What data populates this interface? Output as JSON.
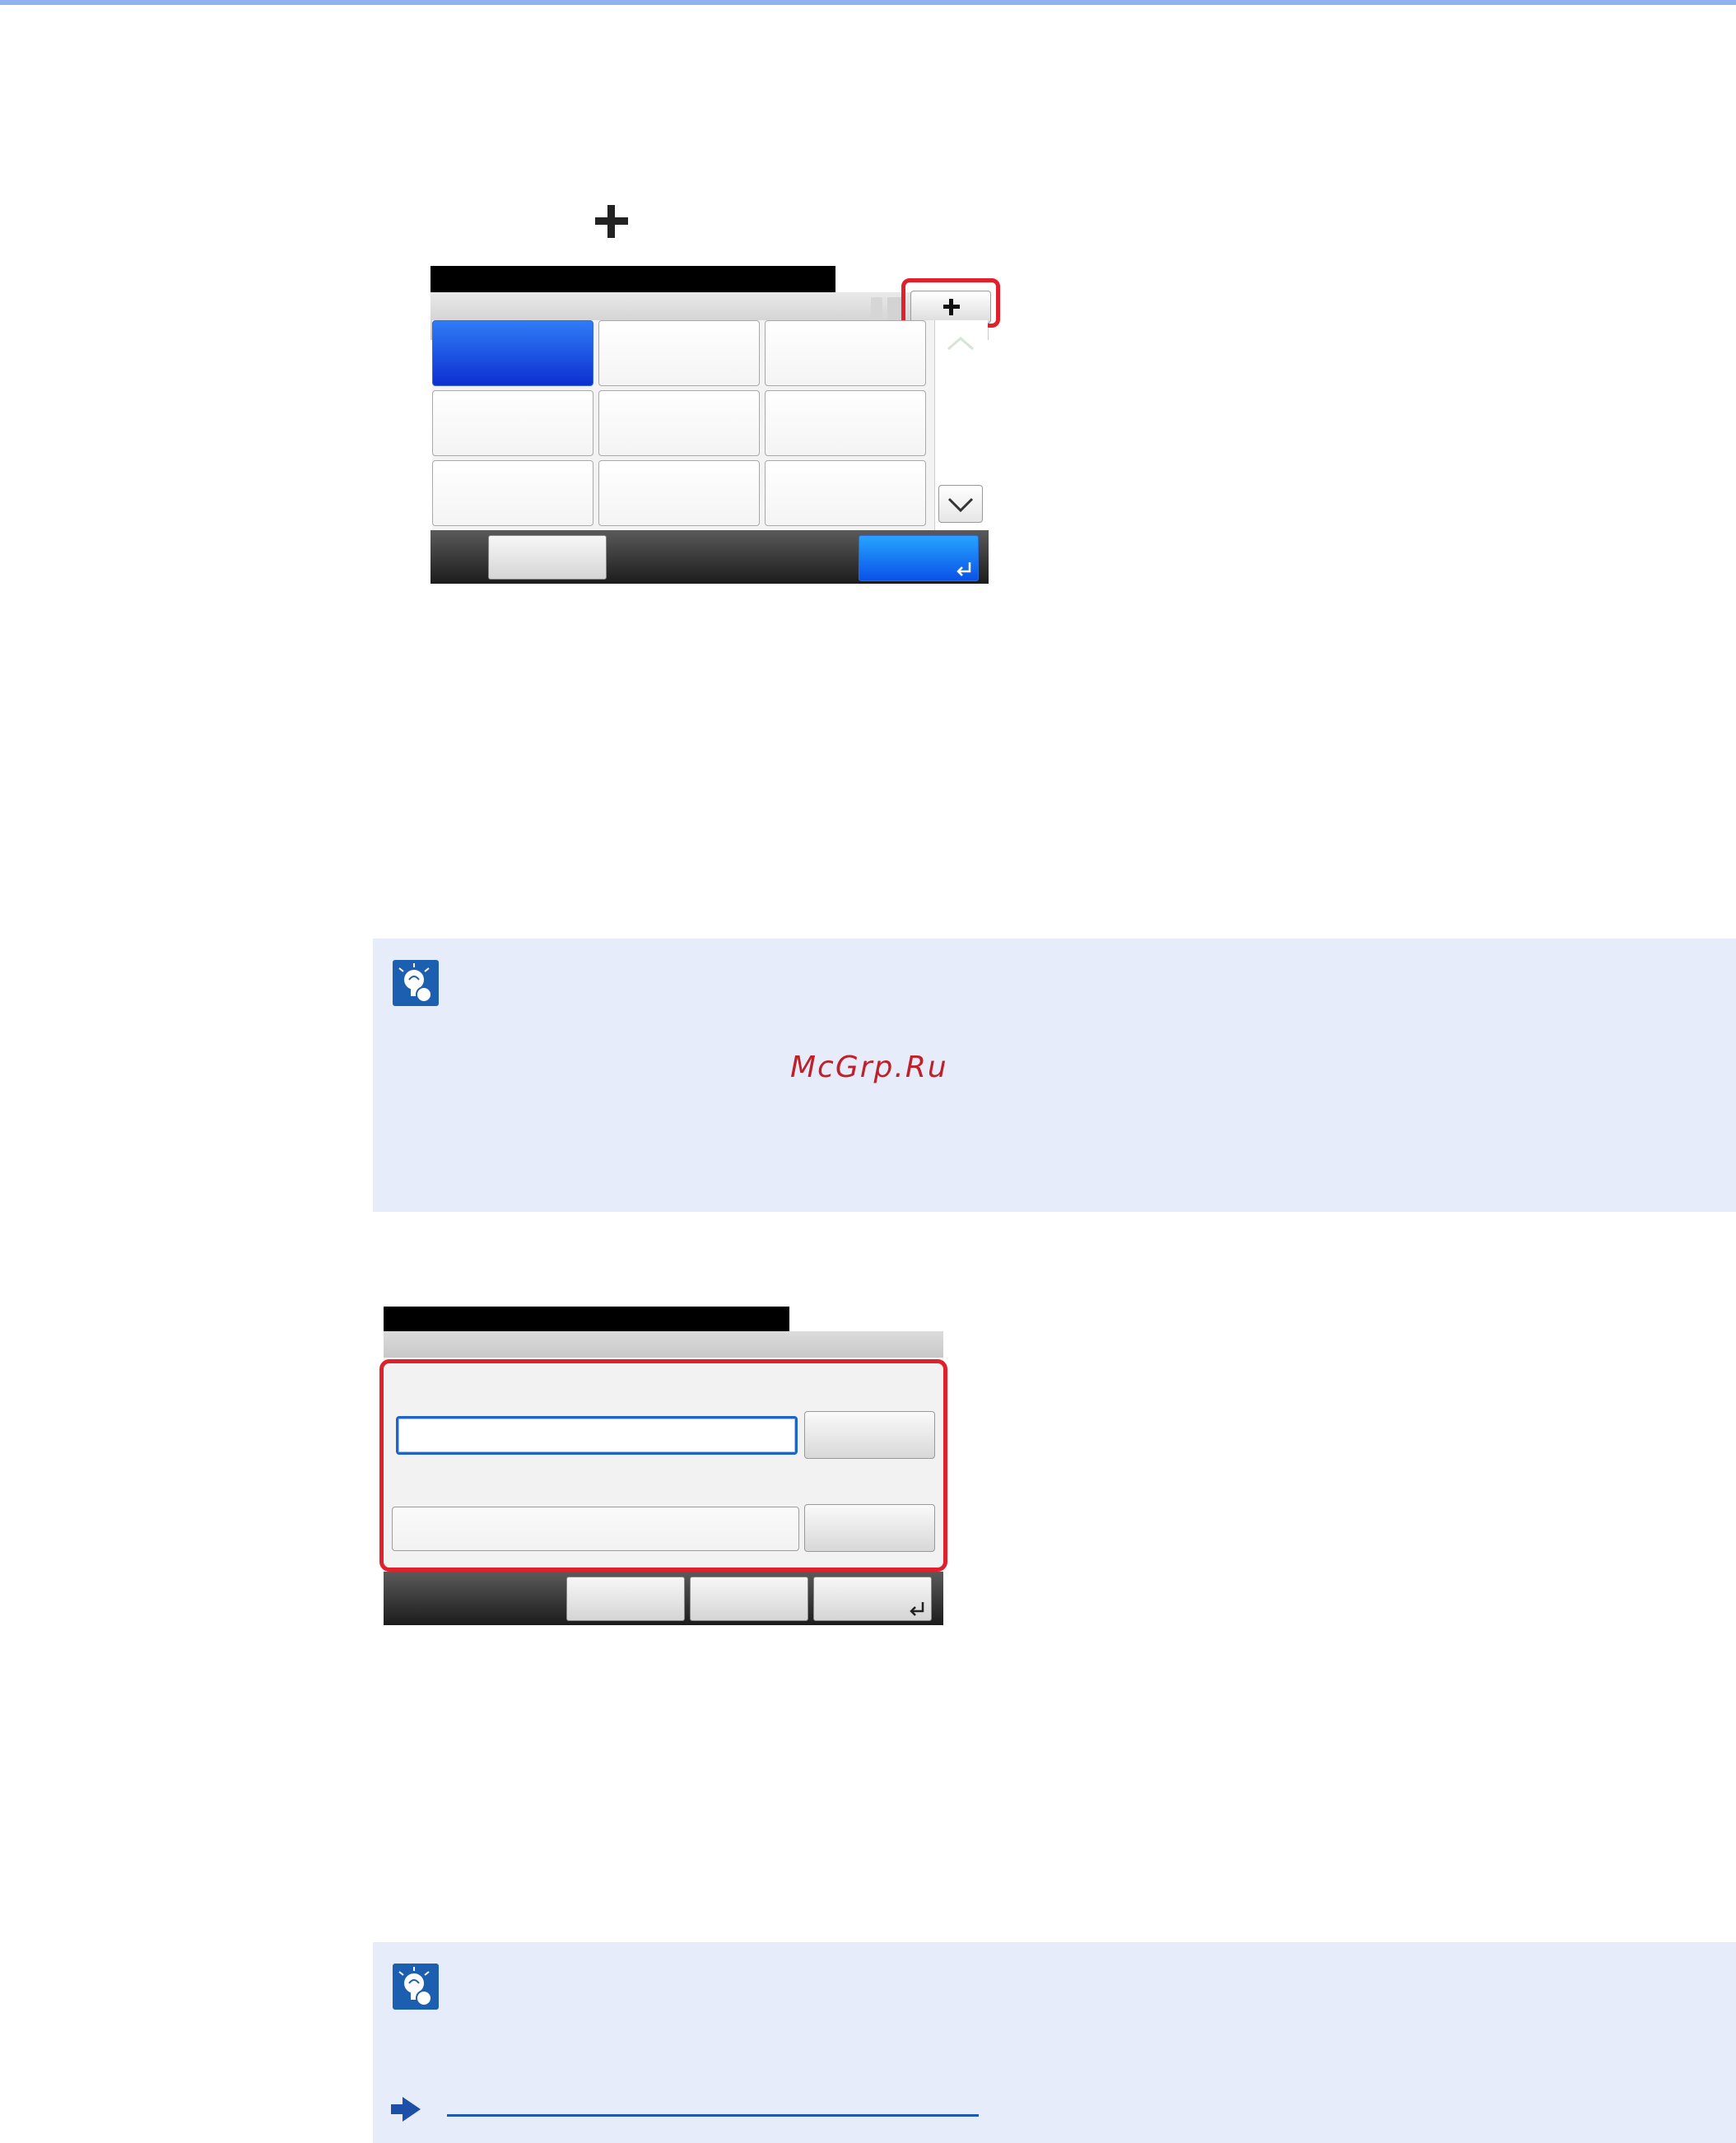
{
  "note1": {
    "watermark": "McGrp.Ru"
  },
  "icons": {
    "step_plus": "plus-icon",
    "note": "lightbulb-note-icon",
    "link": "arrow-right-icon"
  },
  "colors": {
    "highlight": "#e0202c",
    "selected_button": "#1a4fe0",
    "note_background": "#e6ecfa",
    "link": "#1c58b8"
  }
}
